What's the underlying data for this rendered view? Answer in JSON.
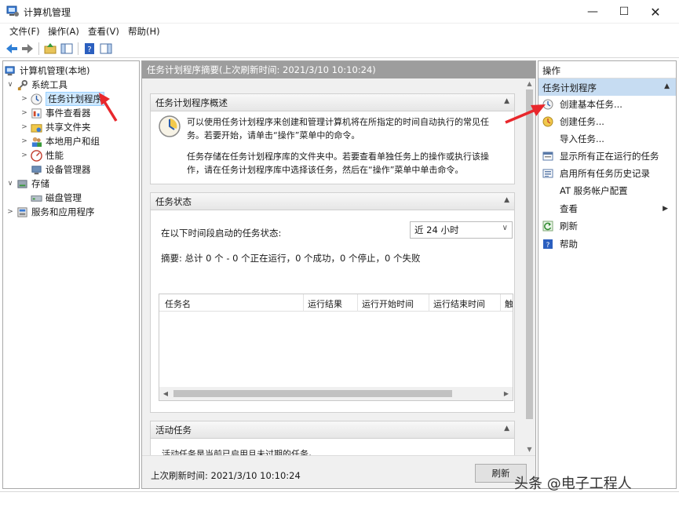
{
  "window": {
    "title": "计算机管理",
    "controls": [
      "minimize",
      "maximize",
      "close"
    ]
  },
  "menubar": [
    "文件(F)",
    "操作(A)",
    "查看(V)",
    "帮助(H)"
  ],
  "tree": {
    "items": [
      {
        "label": "计算机管理(本地)",
        "icon": "computer-management-icon",
        "expander": ""
      },
      {
        "label": "系统工具",
        "icon": "system-tools-icon",
        "expander": "v"
      },
      {
        "label": "任务计划程序",
        "icon": "task-scheduler-icon",
        "expander": ">",
        "selected": true
      },
      {
        "label": "事件查看器",
        "icon": "event-viewer-icon",
        "expander": ">"
      },
      {
        "label": "共享文件夹",
        "icon": "shared-folders-icon",
        "expander": ">"
      },
      {
        "label": "本地用户和组",
        "icon": "local-users-icon",
        "expander": ">"
      },
      {
        "label": "性能",
        "icon": "performance-icon",
        "expander": ">"
      },
      {
        "label": "设备管理器",
        "icon": "device-manager-icon",
        "expander": ""
      },
      {
        "label": "存储",
        "icon": "storage-icon",
        "expander": "v"
      },
      {
        "label": "磁盘管理",
        "icon": "disk-management-icon",
        "expander": ""
      },
      {
        "label": "服务和应用程序",
        "icon": "services-icon",
        "expander": ">"
      }
    ]
  },
  "main": {
    "header": "任务计划程序摘要(上次刷新时间: 2021/3/10 10:10:24)",
    "overview": {
      "title": "任务计划程序概述",
      "para1_line1": "可以使用任务计划程序来创建和管理计算机将在所指定的时间自动执行的常见任",
      "para1_line2": "务。若要开始，请单击“操作”菜单中的命令。",
      "para2_line1": "任务存储在任务计划程序库的文件夹中。若要查看单独任务上的操作或执行该操",
      "para2_line2": "作，请在任务计划程序库中选择该任务，然后在“操作”菜单中单击命令。"
    },
    "status": {
      "title": "任务状态",
      "range_label": "在以下时间段启动的任务状态:",
      "range_value": "近 24 小时",
      "summary": "摘要: 总计 0 个 - 0 个正在运行，0 个成功，0 个停止，0 个失败",
      "columns": [
        "任务名",
        "运行结果",
        "运行开始时间",
        "运行结束时间",
        "触"
      ]
    },
    "active": {
      "title": "活动任务",
      "partial_text": "活动任务是当前已启用且未过期的任务。"
    },
    "footer": {
      "last_refresh": "上次刷新时间: 2021/3/10 10:10:24",
      "refresh_label": "刷新"
    }
  },
  "actions": {
    "title": "操作",
    "section": "任务计划程序",
    "items": [
      {
        "label": "创建基本任务...",
        "icon": "create-basic-task-icon"
      },
      {
        "label": "创建任务...",
        "icon": "create-task-icon"
      },
      {
        "label": "导入任务...",
        "icon": ""
      },
      {
        "label": "显示所有正在运行的任务",
        "icon": "running-tasks-icon"
      },
      {
        "label": "启用所有任务历史记录",
        "icon": "task-history-icon"
      },
      {
        "label": "AT 服务帐户配置",
        "icon": ""
      },
      {
        "label": "查看",
        "icon": "",
        "submenu": true
      },
      {
        "label": "刷新",
        "icon": "refresh-icon"
      },
      {
        "label": "帮助",
        "icon": "help-icon"
      }
    ]
  },
  "watermark": "头条 @电子工程人",
  "colors": {
    "selection": "#cde8ff",
    "action_header": "#c6dcf2",
    "annotation_arrow": "#e8272c"
  }
}
